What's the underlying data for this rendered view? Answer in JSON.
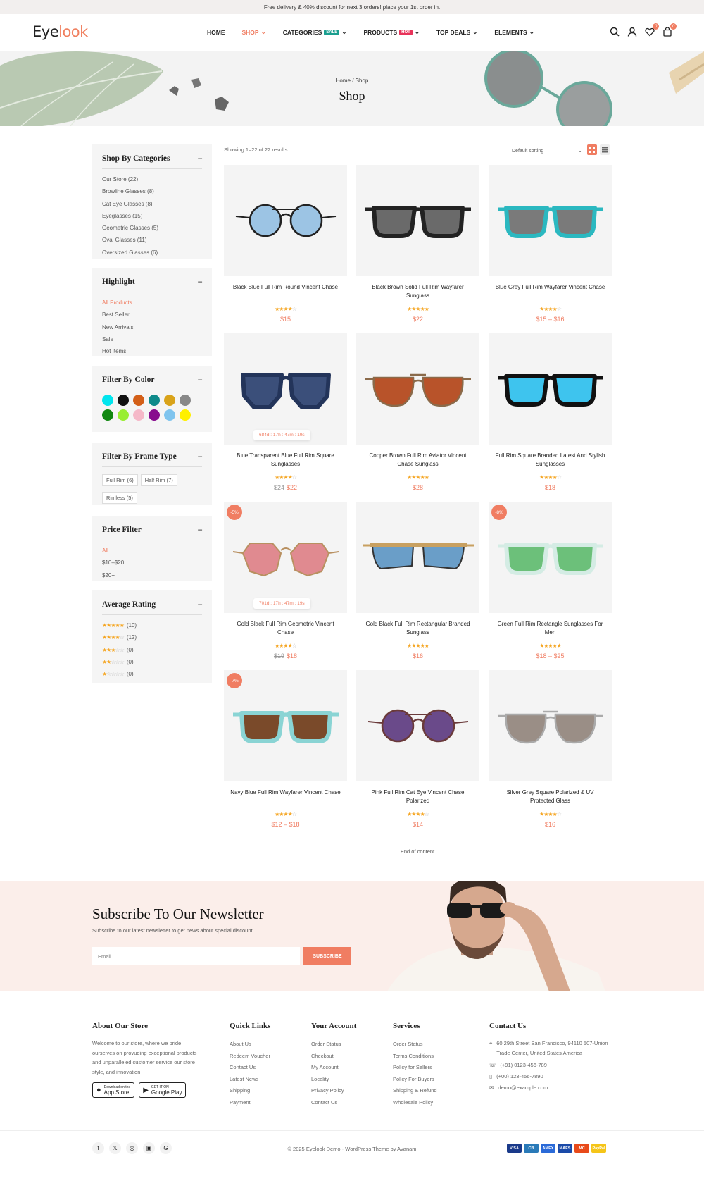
{
  "topbar": {
    "text": "Free delivery & 40% discount for next 3 orders! place your 1st order in."
  },
  "logo": {
    "part1": "Eye",
    "part2": "look"
  },
  "nav": [
    {
      "label": "HOME",
      "chev": ""
    },
    {
      "label": "SHOP",
      "chev": "⌄"
    },
    {
      "label": "CATEGORIES",
      "badge": "SALE",
      "badge_color": "#1a9e8f",
      "chev": "⌄"
    },
    {
      "label": "PRODUCTS",
      "badge": "HOT",
      "badge_color": "#e8335a",
      "chev": "⌄"
    },
    {
      "label": "TOP DEALS",
      "chev": "⌄"
    },
    {
      "label": "ELEMENTS",
      "chev": "⌄"
    }
  ],
  "header_counts": {
    "wishlist": "0",
    "cart": "0"
  },
  "breadcrumb": {
    "home": "Home",
    "sep": "/",
    "current": "Shop"
  },
  "page_title": "Shop",
  "results": "Showing 1–22 of 22 results",
  "sorting": "Default sorting",
  "sidebar": {
    "categories": {
      "title": "Shop By Categories",
      "items": [
        "Our Store (22)",
        "Browline Glasses (8)",
        "Cat Eye Glasses (8)",
        "Eyeglasses (15)",
        "Geometric Glasses (5)",
        "Oval Glasses (11)",
        "Oversized Glasses (6)"
      ]
    },
    "highlight": {
      "title": "Highlight",
      "items": [
        "All Products",
        "Best Seller",
        "New Arrivals",
        "Sale",
        "Hot Items"
      ]
    },
    "color": {
      "title": "Filter By Color",
      "colors": [
        "#00e5ee",
        "#111111",
        "#d35f18",
        "#0e8a8a",
        "#d9a31a",
        "#888888",
        "#118811",
        "#99ee33",
        "#f5b8c8",
        "#880e8e",
        "#7fc4ee",
        "#fff000"
      ]
    },
    "frame": {
      "title": "Filter By Frame Type",
      "items": [
        "Full Rim (6)",
        "Half Rim (7)",
        "Rimless (5)"
      ]
    },
    "price": {
      "title": "Price Filter",
      "items": [
        "All",
        "$10–$20",
        "$20+"
      ]
    },
    "rating": {
      "title": "Average Rating",
      "items": [
        {
          "stars": 5,
          "count": "(10)"
        },
        {
          "stars": 4,
          "count": "(12)"
        },
        {
          "stars": 3,
          "count": "(0)"
        },
        {
          "stars": 2,
          "count": "(0)"
        },
        {
          "stars": 1,
          "count": "(0)"
        }
      ]
    }
  },
  "products": [
    {
      "name": "Black Blue Full Rim Round Vincent Chase",
      "rating": 4,
      "old": "",
      "price": "$15",
      "frame": "#222",
      "lens": "#9cc4e4",
      "shape": "round"
    },
    {
      "name": "Black Brown Solid Full Rim Wayfarer Sunglass",
      "rating": 5,
      "old": "",
      "price": "$22",
      "frame": "#222",
      "lens": "#6a6a6a",
      "shape": "way"
    },
    {
      "name": "Blue Grey Full Rim Wayfarer Vincent Chase",
      "rating": 4,
      "old": "",
      "price": "$15 – $16",
      "frame": "#2bb8c0",
      "lens": "#7a7a7a",
      "shape": "way"
    },
    {
      "name": "Blue Transparent Blue Full Rim Square Sunglasses",
      "rating": 4,
      "old": "$24",
      "price": "$22",
      "frame": "#23345a",
      "lens": "#3b4f7a",
      "shape": "sq",
      "timer": "684d : 17h : 47m : 19s"
    },
    {
      "name": "Copper Brown Full Rim Aviator Vincent Chase Sunglass",
      "rating": 5,
      "old": "",
      "price": "$28",
      "frame": "#8a6a4a",
      "lens": "#b8532a",
      "shape": "avi"
    },
    {
      "name": "Full Rim Square Branded Latest And Stylish Sunglasses",
      "rating": 4,
      "old": "",
      "price": "$18",
      "frame": "#111",
      "lens": "#3ec4ee",
      "shape": "way"
    },
    {
      "name": "Gold Black Full Rim Geometric Vincent Chase",
      "rating": 4,
      "old": "$19",
      "price": "$18",
      "frame": "#b89060",
      "lens": "#e08a90",
      "shape": "geo",
      "disc": "-5%",
      "timer": "701d : 17h : 47m : 19s"
    },
    {
      "name": "Gold Black Full Rim Rectangular Branded Sunglass",
      "rating": 5,
      "old": "",
      "price": "$16",
      "frame": "#c8a060",
      "lens": "#6a9ec8",
      "shape": "rect"
    },
    {
      "name": "Green Full Rim Rectangle Sunglasses For Men",
      "rating": 5,
      "old": "",
      "price": "$18 – $25",
      "frame": "#d4ece4",
      "lens": "#6cc07a",
      "shape": "way",
      "disc": "-8%"
    },
    {
      "name": "Navy Blue Full Rim Wayfarer Vincent Chase",
      "rating": 4,
      "old": "",
      "price": "$12 – $18",
      "frame": "#8ad4d4",
      "lens": "#7a4a2a",
      "shape": "way",
      "disc": "-7%"
    },
    {
      "name": "Pink Full Rim Cat Eye Vincent Chase Polarized",
      "rating": 4,
      "old": "",
      "price": "$14",
      "frame": "#6a3a3a",
      "lens": "#6a4a8a",
      "shape": "round"
    },
    {
      "name": "Silver Grey Square Polarized & UV Protected Glass",
      "rating": 4,
      "old": "",
      "price": "$16",
      "frame": "#aaa",
      "lens": "#9a8e86",
      "shape": "avi"
    }
  ],
  "end_text": "End of content",
  "newsletter": {
    "title": "Subscribe To Our Newsletter",
    "subtitle": "Subscribe to our latest newsletter to get news about special discount.",
    "placeholder": "Email",
    "button": "SUBSCRIBE"
  },
  "footer": {
    "about": {
      "title": "About Our Store",
      "text": "Welcome to our store, where we pride ourselves on provuding exceptional products and unparalleled customer service our store style, and innovation",
      "app1_small": "Download on the",
      "app1": "App Store",
      "app2_small": "GET IT ON",
      "app2": "Google Play"
    },
    "quick": {
      "title": "Quick Links",
      "items": [
        "About Us",
        "Redeem Voucher",
        "Contact Us",
        "Latest News",
        "Shipping",
        "Payment"
      ]
    },
    "account": {
      "title": "Your Account",
      "items": [
        "Order Status",
        "Checkout",
        "My Account",
        "Locality",
        "Privacy Policy",
        "Contact Us"
      ]
    },
    "services": {
      "title": "Services",
      "items": [
        "Order Status",
        "Terms Conditions",
        "Policy for Sellers",
        "Policy For Buyers",
        "Shipping & Refund",
        "Wholesale Policy"
      ]
    },
    "contact": {
      "title": "Contact Us",
      "address": "60 29th Street San Francisco, 94110 507-Union Trade Center, United States America",
      "phone1": "(+91) 0123-456-789",
      "phone2": "(+00) 123-456-7890",
      "email": "demo@example.com"
    },
    "copyright": "© 2025 Eyelook Demo - WordPress Theme by Avanam",
    "social": [
      "f",
      "𝕏",
      "◎",
      "▣",
      "G"
    ],
    "payments": [
      {
        "label": "VISA",
        "color": "#1a3a8a"
      },
      {
        "label": "CB",
        "color": "#2a7ab8"
      },
      {
        "label": "AMEX",
        "color": "#2a6ad8"
      },
      {
        "label": "MAES",
        "color": "#1a4aa8"
      },
      {
        "label": "MC",
        "color": "#e84a1a"
      },
      {
        "label": "PayPal",
        "color": "#f5c518"
      }
    ]
  }
}
